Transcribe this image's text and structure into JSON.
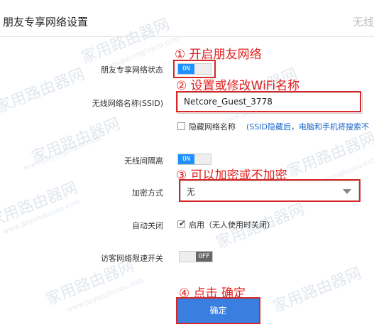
{
  "header": {
    "title": "朋友专享网络设置",
    "right_text": "无线"
  },
  "annotations": {
    "step1": "① 开启朋友网络",
    "step2": "② 设置或修改WiFi名称",
    "step3": "③ 可以加密或不加密",
    "step4": "④ 点击 确定"
  },
  "form": {
    "network_status": {
      "label": "朋友专享网络状态",
      "toggle_text": "ON"
    },
    "ssid": {
      "label": "无线网络名称(SSID)",
      "value": "Netcore_Guest_3778"
    },
    "hide_ssid": {
      "label": "隐藏网络名称",
      "hint": "(SSID隐藏后，电脑和手机将搜索不"
    },
    "isolation": {
      "label": "无线间隔离",
      "toggle_text": "ON"
    },
    "encryption": {
      "label": "加密方式",
      "value": "无"
    },
    "auto_close": {
      "label": "自动关闭",
      "checkbox_label": "启用（无人使用时关闭）"
    },
    "speed_limit": {
      "label": "访客网络限速开关",
      "toggle_text": "OFF"
    }
  },
  "buttons": {
    "confirm": "确定"
  },
  "watermark": {
    "cn": "家用路由器网",
    "en": "www.jiayongluyou.com"
  },
  "colors": {
    "accent": "#1e90ff",
    "annotation_red": "#e02020",
    "button": "#3a7fe0"
  }
}
